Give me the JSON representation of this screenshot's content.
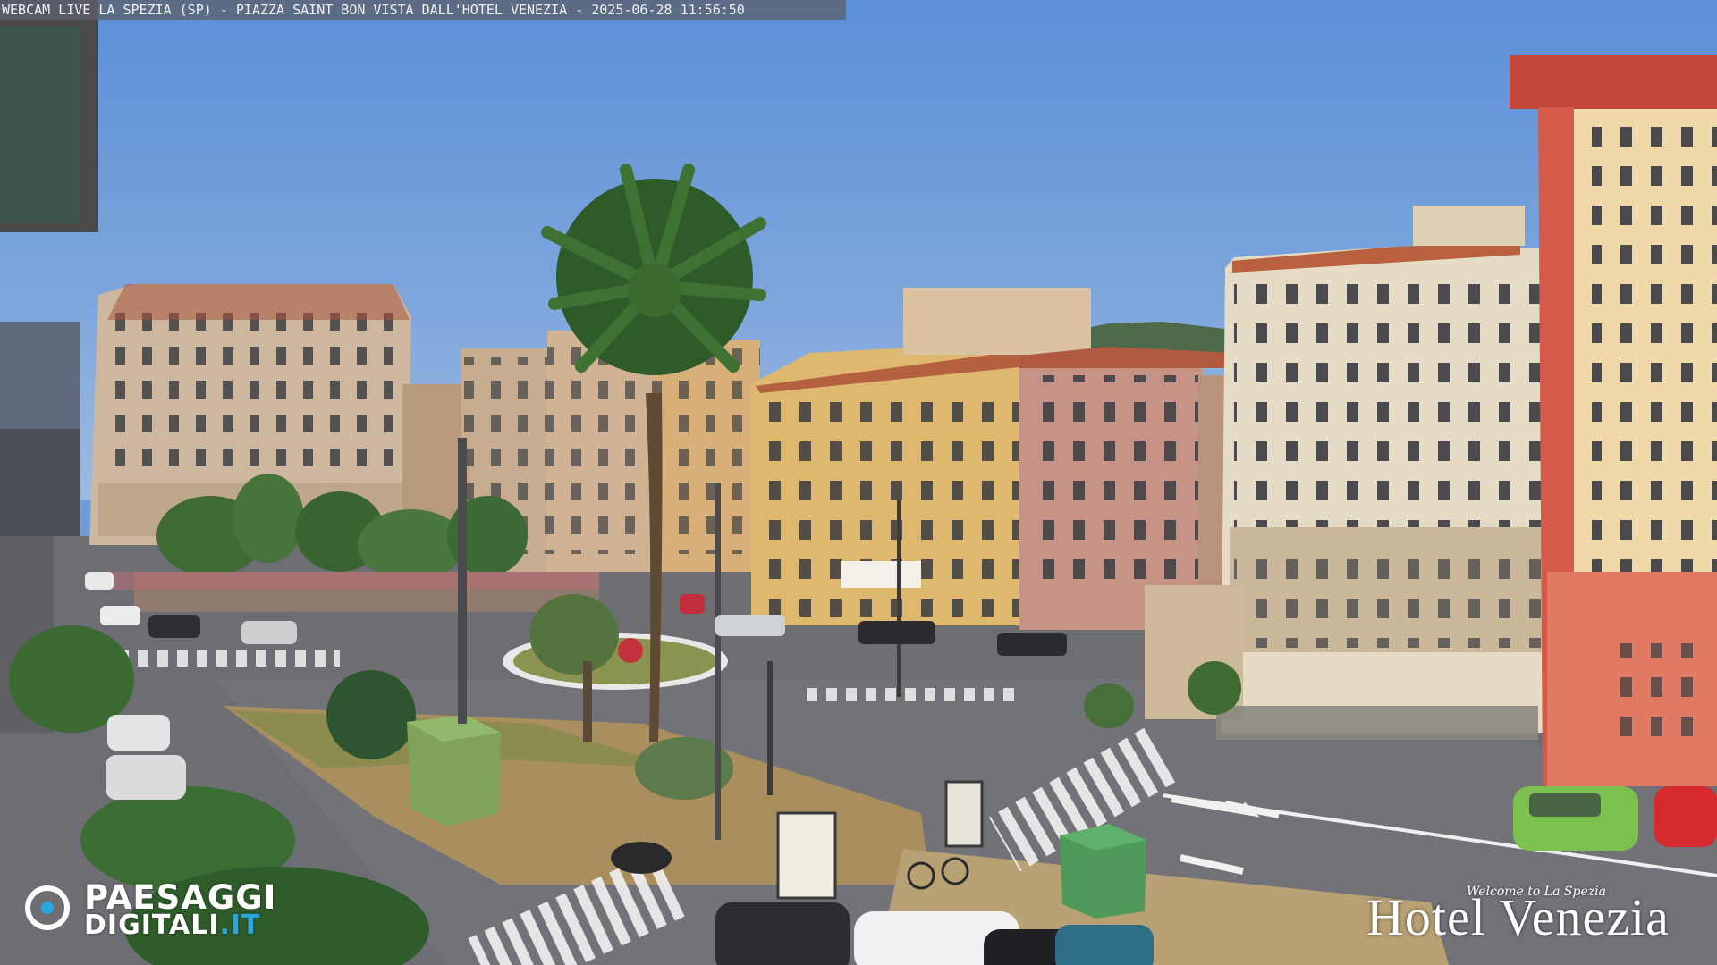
{
  "overlay": {
    "caption": "WEBCAM LIVE LA SPEZIA (SP) - PIAZZA SAINT BON VISTA DALL'HOTEL VENEZIA - 2025-06-28 11:56:50",
    "logo_left_line1": "PAESAGGI",
    "logo_left_line2": "DIGITALI",
    "logo_left_tld": ".IT",
    "logo_right_welcome": "Welcome to La Spezia",
    "logo_right_name": "Hotel Venezia"
  },
  "colors": {
    "sky": "#6f9bd6",
    "road": "#6c6d72",
    "accent_blue": "#2aa6df"
  }
}
